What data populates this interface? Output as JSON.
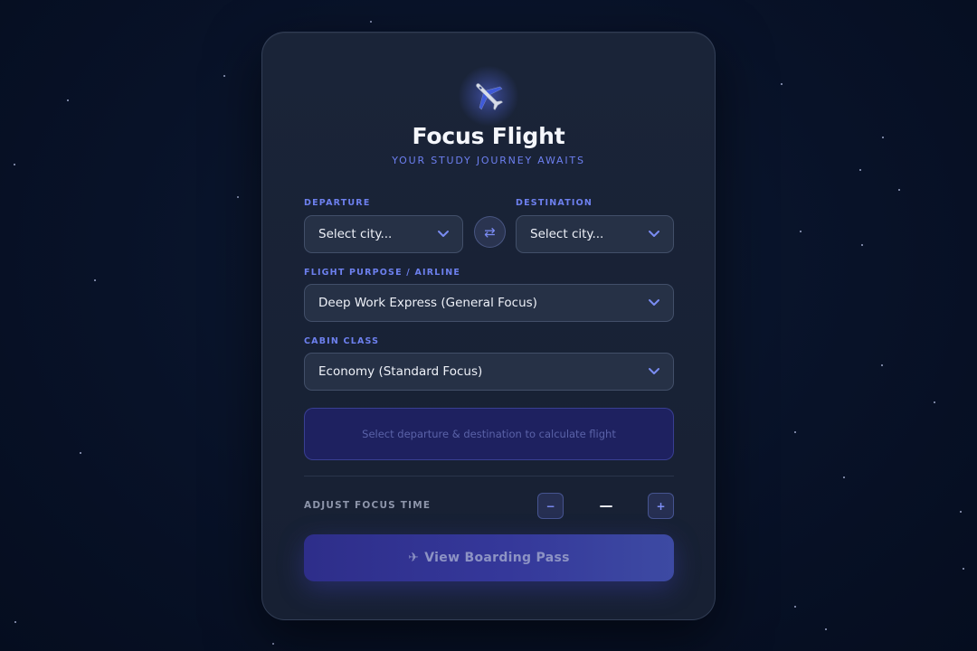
{
  "app": {
    "title": "Focus Flight",
    "subtitle": "YOUR STUDY JOURNEY AWAITS",
    "icon": "airplane-icon"
  },
  "route": {
    "departure_label": "DEPARTURE",
    "departure_value": "Select city...",
    "destination_label": "DESTINATION",
    "destination_value": "Select city...",
    "swap_icon": "swap-arrows-icon",
    "swap_glyph": "⇄"
  },
  "purpose": {
    "label": "FLIGHT PURPOSE / AIRLINE",
    "value": "Deep Work Express (General Focus)"
  },
  "cabin": {
    "label": "CABIN CLASS",
    "value": "Economy (Standard Focus)"
  },
  "info_text": "Select departure & destination to calculate flight",
  "focus_time": {
    "label": "ADJUST FOCUS TIME",
    "decrement": "−",
    "increment": "+",
    "value": "—"
  },
  "boarding_button": {
    "icon": "✈",
    "label": "View Boarding Pass"
  },
  "colors": {
    "accent": "#6d80ee",
    "card": "#1a2438",
    "background": "#081228",
    "button": "#35389a"
  }
}
